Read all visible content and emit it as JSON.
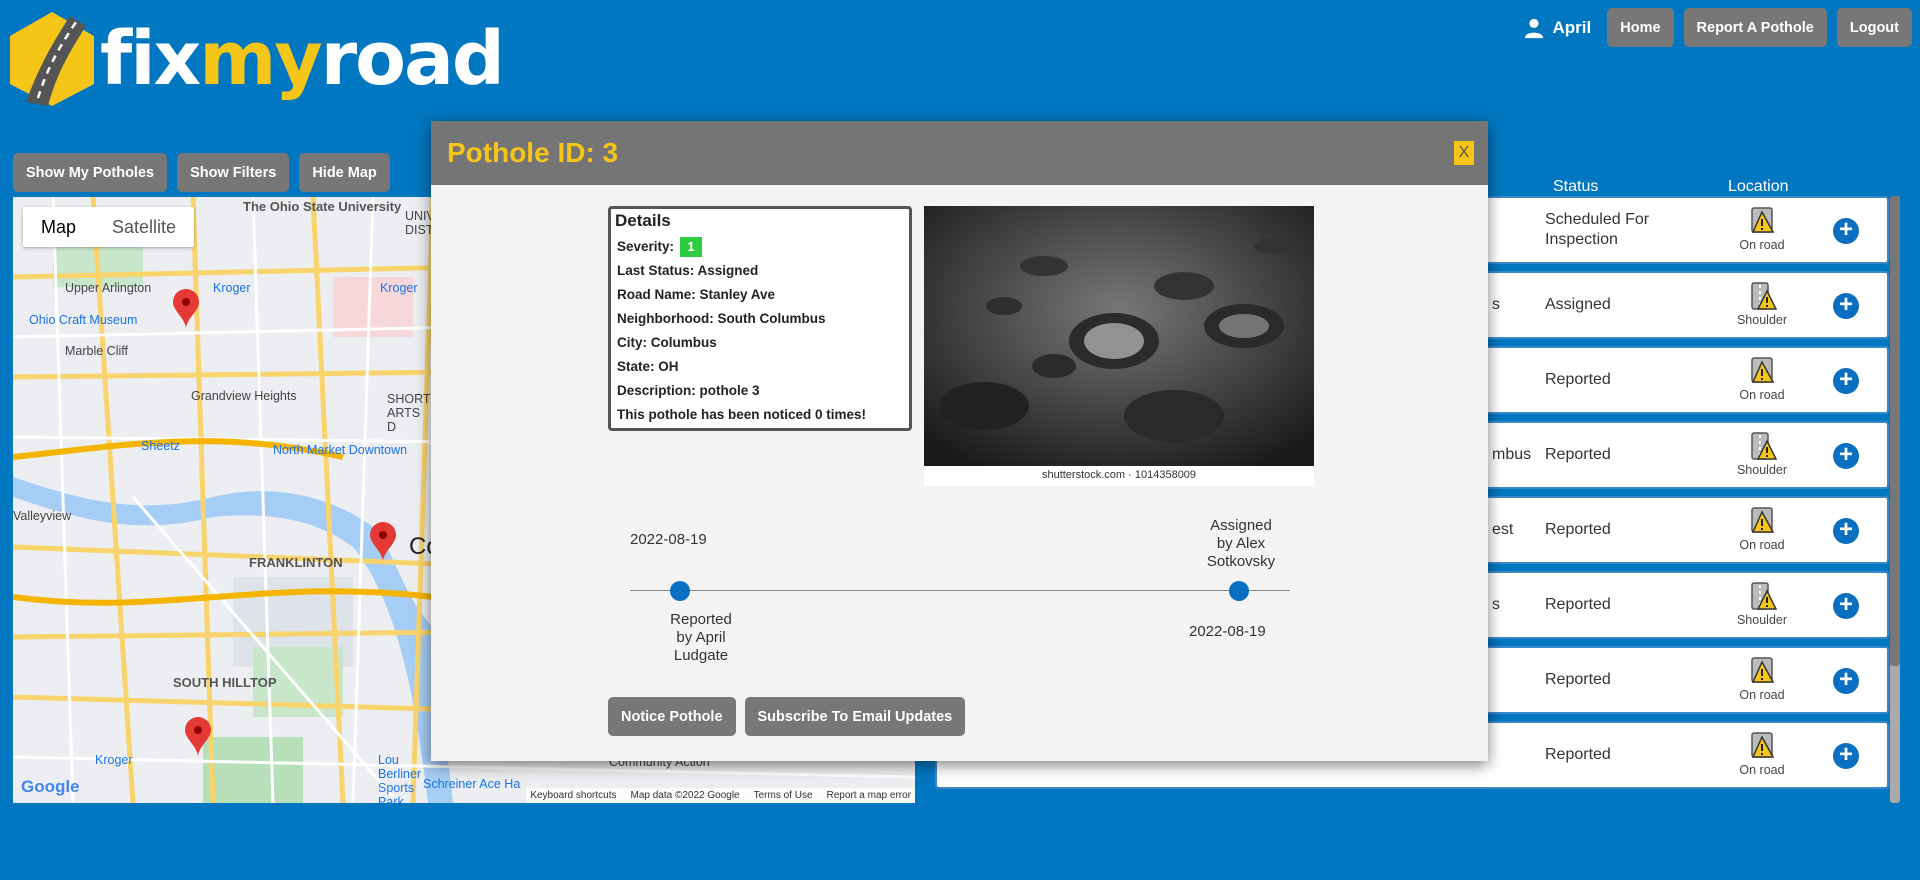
{
  "brand": {
    "part1": "fix",
    "part2": "my",
    "part3": "road"
  },
  "topnav": {
    "user": "April",
    "home": "Home",
    "report": "Report A Pothole",
    "logout": "Logout"
  },
  "filters": {
    "my_potholes": "Show My Potholes",
    "show_filters": "Show Filters",
    "hide_map": "Hide Map"
  },
  "map": {
    "toggle_map": "Map",
    "toggle_satellite": "Satellite",
    "labels": {
      "osu": "The Ohio State University",
      "upper_arlington": "Upper Arlington",
      "kroger1": "Kroger",
      "craft_museum": "Ohio Craft Museum",
      "marble_cliff": "Marble Cliff",
      "grandview": "Grandview Heights",
      "sheetz": "Sheetz",
      "north_market": "North Market Downtown",
      "valleyview": "Valleyview",
      "franklinton": "FRANKLINTON",
      "south_hilltop": "SOUTH HILLTOP",
      "kroger2": "Kroger",
      "lou_berliner": "Lou Berliner Sports Park",
      "community_action": "Community Action",
      "schreiner": "Schreiner Ace Ha",
      "cosi": "Co",
      "kroger3": "Kroger",
      "short_north": "SHORT ARTS D",
      "univ": "UNIVERSI DISTRIC"
    },
    "footer": {
      "shortcuts": "Keyboard shortcuts",
      "data": "Map data ©2022 Google",
      "terms": "Terms of Use",
      "report": "Report a map error"
    },
    "google": "Google"
  },
  "table": {
    "headers": {
      "status": "Status",
      "location": "Location"
    },
    "rows": [
      {
        "neigh": "",
        "status": "Scheduled For Inspection",
        "loc": "On road",
        "loc_icon": "on-road-icon"
      },
      {
        "neigh": "s",
        "status": "Assigned",
        "loc": "Shoulder",
        "loc_icon": "shoulder-icon"
      },
      {
        "neigh": "",
        "status": "Reported",
        "loc": "On road",
        "loc_icon": "on-road-icon"
      },
      {
        "neigh": "mbus",
        "status": "Reported",
        "loc": "Shoulder",
        "loc_icon": "shoulder-icon"
      },
      {
        "neigh": "est",
        "status": "Reported",
        "loc": "On road",
        "loc_icon": "on-road-icon"
      },
      {
        "neigh": "s",
        "status": "Reported",
        "loc": "Shoulder",
        "loc_icon": "shoulder-icon"
      },
      {
        "neigh": "",
        "status": "Reported",
        "loc": "On road",
        "loc_icon": "on-road-icon"
      },
      {
        "neigh": "",
        "status": "Reported",
        "loc": "On road",
        "loc_icon": "on-road-icon"
      }
    ]
  },
  "modal": {
    "title": "Pothole ID: 3",
    "close": "X",
    "details_heading": "Details",
    "severity_label": "Severity:",
    "severity": "1",
    "last_status": "Last Status: Assigned",
    "road_name": "Road Name: Stanley Ave",
    "neighborhood": "Neighborhood: South Columbus",
    "city": "City: Columbus",
    "state": "State: OH",
    "description": "Description: pothole 3",
    "noticed": "This pothole has been noticed 0 times!",
    "photo_credit": "shutterstock.com · 1014358009",
    "timeline": {
      "ev1_date": "2022-08-19",
      "ev1_text1": "Reported",
      "ev1_text2": "by April",
      "ev1_text3": "Ludgate",
      "ev2_date": "2022-08-19",
      "ev2_text1": "Assigned",
      "ev2_text2": "by Alex",
      "ev2_text3": "Sotkovsky"
    },
    "notice_btn": "Notice Pothole",
    "subscribe_btn": "Subscribe To Email Updates"
  },
  "colors": {
    "brand_blue": "#0277c1",
    "accent_yellow": "#f5c518",
    "button_gray": "#777777",
    "severity_green": "#2ecc40"
  }
}
